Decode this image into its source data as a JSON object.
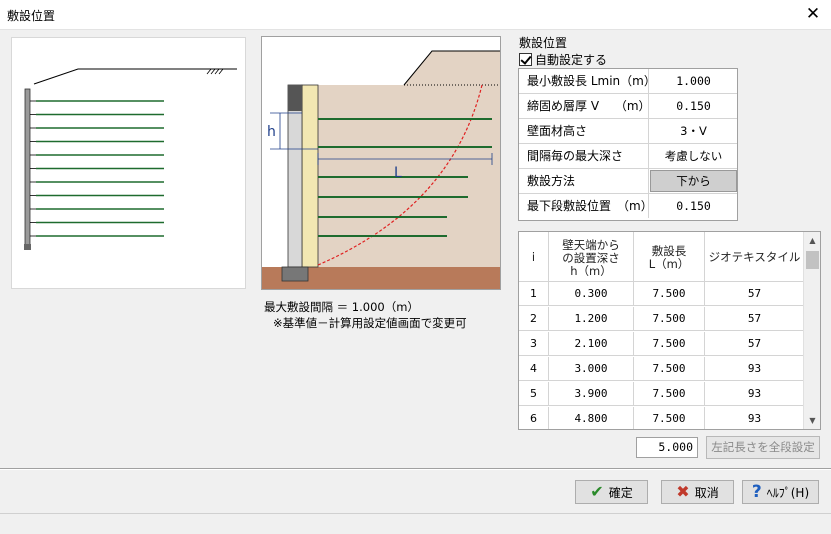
{
  "window": {
    "title": "敷設位置",
    "close_glyph": "✕"
  },
  "diagram": {
    "h_label": "h",
    "L_label": "L"
  },
  "notes": {
    "max_interval": "最大敷設間隔 ＝ 1.000（m）",
    "hint": "※基準値－計算用設定値画面で変更可"
  },
  "settings": {
    "section_label": "敷設位置",
    "auto_label": "自動設定する",
    "auto_checked": true,
    "rows": [
      {
        "label": "最小敷設長 Lmin（m）",
        "value": "1.000"
      },
      {
        "label": "締固め層厚 V　 （m）",
        "value": "0.150"
      },
      {
        "label": "壁面材高さ",
        "value": "3・V"
      },
      {
        "label": "間隔毎の最大深さ",
        "value": "考慮しない"
      },
      {
        "label": "敷設方法",
        "value": "下から"
      },
      {
        "label": "最下段敷設位置　（m）",
        "value": "0.150"
      }
    ]
  },
  "table": {
    "headers": [
      "i",
      "壁天端から\nの設置深さ\nh（m）",
      "敷設長\nL（m）",
      "ジオテキスタイル"
    ],
    "rows": [
      [
        "1",
        "0.300",
        "7.500",
        "57"
      ],
      [
        "2",
        "1.200",
        "7.500",
        "57"
      ],
      [
        "3",
        "2.100",
        "7.500",
        "57"
      ],
      [
        "4",
        "3.000",
        "7.500",
        "93"
      ],
      [
        "5",
        "3.900",
        "7.500",
        "93"
      ],
      [
        "6",
        "4.800",
        "7.500",
        "93"
      ]
    ]
  },
  "length_tool": {
    "value": "5.000",
    "button_label": "左記長さを全段設定"
  },
  "footer": {
    "ok_label": "確定",
    "cancel_label": "取消",
    "help_label": "ﾍﾙﾌﾟ(H)"
  },
  "colors": {
    "grid_line": "#1e6b2e",
    "soil": "#e3d3c4",
    "ground": "#b87a5a",
    "facing": "#f2e7b2",
    "dim": "#1f3f8a",
    "slip": "#e02020"
  }
}
